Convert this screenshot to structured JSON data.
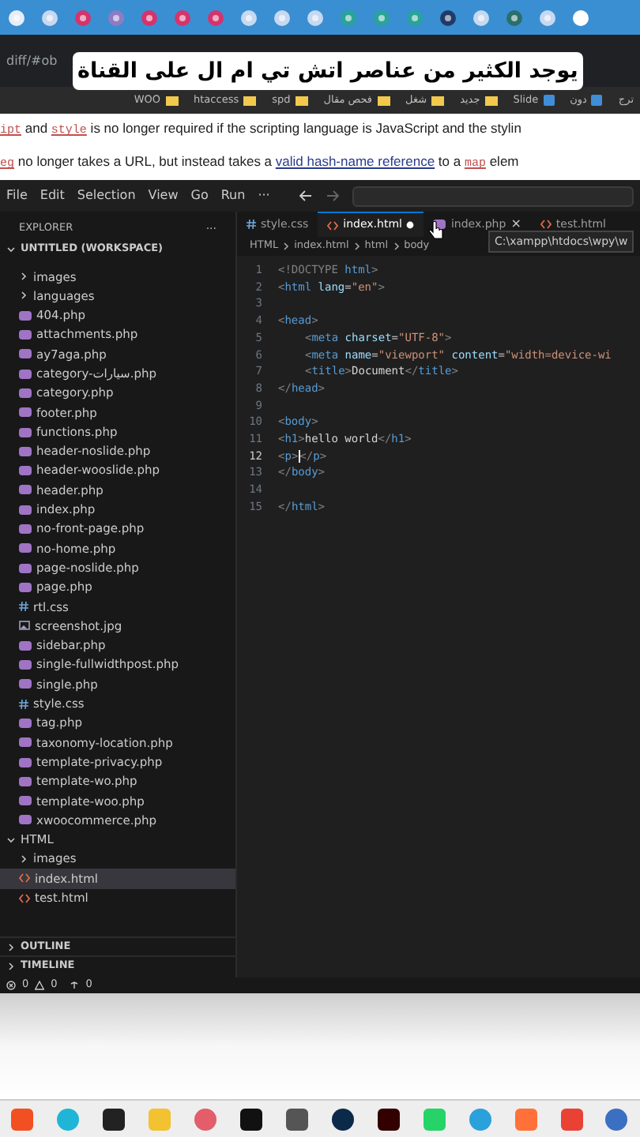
{
  "browser": {
    "address": "diff/#ob",
    "caption": "يوجد الكثير من عناصر اتش تي ام ال على القناة",
    "bookmarks": [
      {
        "label": "ترج",
        "kind": "text"
      },
      {
        "label": "دون",
        "kind": "app"
      },
      {
        "label": "Slide",
        "kind": "app"
      },
      {
        "label": "جديد",
        "kind": "folder"
      },
      {
        "label": "شغل",
        "kind": "folder"
      },
      {
        "label": "فحص مقال",
        "kind": "folder"
      },
      {
        "label": "spd",
        "kind": "folder"
      },
      {
        "label": "htaccess",
        "kind": "folder"
      },
      {
        "label": "WOO",
        "kind": "folder"
      }
    ],
    "page_lines": [
      [
        {
          "kind": "code",
          "t": "ipt"
        },
        {
          "kind": "text",
          "t": " and "
        },
        {
          "kind": "code",
          "t": "style"
        },
        {
          "kind": "text",
          "t": " is no longer required if the scripting language is JavaScript and the stylin"
        }
      ],
      [
        {
          "kind": "code",
          "t": "eg"
        },
        {
          "kind": "text",
          "t": " no longer takes a URL, but instead takes a "
        },
        {
          "kind": "link",
          "t": "valid hash-name reference"
        },
        {
          "kind": "text",
          "t": " to a "
        },
        {
          "kind": "code",
          "t": "map"
        },
        {
          "kind": "text",
          "t": " elem"
        }
      ]
    ]
  },
  "editor": {
    "menu": [
      "File",
      "Edit",
      "Selection",
      "View",
      "Go",
      "Run",
      "···"
    ],
    "explorer": {
      "title": "EXPLORER",
      "more": "···",
      "workspace": "UNTITLED (WORKSPACE)",
      "tree": [
        {
          "kind": "group",
          "children": [
            {
              "label": "images",
              "kind": "folder",
              "expanded": false,
              "selected": false
            },
            {
              "label": "languages",
              "kind": "folder",
              "expanded": false,
              "selected": false
            },
            {
              "label": "404.php",
              "kind": "php",
              "selected": false
            },
            {
              "label": "attachments.php",
              "kind": "php",
              "selected": false
            },
            {
              "label": "ay7aga.php",
              "kind": "php",
              "selected": false
            },
            {
              "label": "category-سيارات.php",
              "kind": "php",
              "selected": false
            },
            {
              "label": "category.php",
              "kind": "php",
              "selected": false
            },
            {
              "label": "footer.php",
              "kind": "php",
              "selected": false
            },
            {
              "label": "functions.php",
              "kind": "php",
              "selected": false
            },
            {
              "label": "header-noslide.php",
              "kind": "php",
              "selected": false
            },
            {
              "label": "header-wooslide.php",
              "kind": "php",
              "selected": false
            },
            {
              "label": "header.php",
              "kind": "php",
              "selected": false
            },
            {
              "label": "index.php",
              "kind": "php",
              "selected": false
            },
            {
              "label": "no-front-page.php",
              "kind": "php",
              "selected": false
            },
            {
              "label": "no-home.php",
              "kind": "php",
              "selected": false
            },
            {
              "label": "page-noslide.php",
              "kind": "php",
              "selected": false
            },
            {
              "label": "page.php",
              "kind": "php",
              "selected": false
            },
            {
              "label": "rtl.css",
              "kind": "css",
              "selected": false
            },
            {
              "label": "screenshot.jpg",
              "kind": "image",
              "selected": false
            },
            {
              "label": "sidebar.php",
              "kind": "php",
              "selected": false
            },
            {
              "label": "single-fullwidthpost.php",
              "kind": "php",
              "selected": false
            },
            {
              "label": "single.php",
              "kind": "php",
              "selected": false
            },
            {
              "label": "style.css",
              "kind": "css",
              "selected": false
            },
            {
              "label": "tag.php",
              "kind": "php",
              "selected": false
            },
            {
              "label": "taxonomy-location.php",
              "kind": "php",
              "selected": false
            },
            {
              "label": "template-privacy.php",
              "kind": "php",
              "selected": false
            },
            {
              "label": "template-wo.php",
              "kind": "php",
              "selected": false
            },
            {
              "label": "template-woo.php",
              "kind": "php",
              "selected": false
            },
            {
              "label": "xwoocommerce.php",
              "kind": "php",
              "selected": false
            }
          ]
        },
        {
          "label": "HTML",
          "kind": "folder",
          "expanded": true,
          "selected": false,
          "children": [
            {
              "label": "images",
              "kind": "folder",
              "expanded": false,
              "selected": false
            },
            {
              "label": "index.html",
              "kind": "html",
              "selected": true
            },
            {
              "label": "test.html",
              "kind": "html",
              "selected": false
            }
          ]
        }
      ],
      "panels": [
        {
          "label": "OUTLINE",
          "expanded": false
        },
        {
          "label": "TIMELINE",
          "expanded": false
        }
      ]
    },
    "tabs": [
      {
        "label": "style.css",
        "kind": "css",
        "selected": false,
        "modified": false
      },
      {
        "label": "index.html",
        "kind": "html",
        "selected": true,
        "modified": true
      },
      {
        "label": "index.php",
        "kind": "php",
        "selected": false,
        "modified": false,
        "close": "×"
      },
      {
        "label": "test.html",
        "kind": "html",
        "selected": false,
        "modified": false
      }
    ],
    "breadcrumb": [
      "HTML",
      "index.html",
      "html",
      "body"
    ],
    "tooltip": "C:\\xampp\\htdocs\\wpy\\w",
    "lines": [
      {
        "n": "1",
        "tokens": [
          {
            "kind": "punct",
            "t": "<!DOCTYPE "
          },
          {
            "kind": "tag",
            "t": "html"
          },
          {
            "kind": "punct",
            "t": ">"
          }
        ]
      },
      {
        "n": "2",
        "tokens": [
          {
            "kind": "punct",
            "t": "<"
          },
          {
            "kind": "tag",
            "t": "html"
          },
          {
            "kind": "attr",
            "t": " lang"
          },
          {
            "kind": "text",
            "t": "="
          },
          {
            "kind": "str",
            "t": "\"en\""
          },
          {
            "kind": "punct",
            "t": ">"
          }
        ]
      },
      {
        "n": "3"
      },
      {
        "n": "4",
        "tokens": [
          {
            "kind": "punct",
            "t": "<"
          },
          {
            "kind": "tag",
            "t": "head"
          },
          {
            "kind": "punct",
            "t": ">"
          }
        ]
      },
      {
        "n": "5",
        "indent": true,
        "tokens": [
          {
            "kind": "punct",
            "t": "<"
          },
          {
            "kind": "tag",
            "t": "meta"
          },
          {
            "kind": "attr",
            "t": " charset"
          },
          {
            "kind": "text",
            "t": "="
          },
          {
            "kind": "str",
            "t": "\"UTF-8\""
          },
          {
            "kind": "punct",
            "t": ">"
          }
        ]
      },
      {
        "n": "6",
        "indent": true,
        "tokens": [
          {
            "kind": "punct",
            "t": "<"
          },
          {
            "kind": "tag",
            "t": "meta"
          },
          {
            "kind": "attr",
            "t": " name"
          },
          {
            "kind": "text",
            "t": "="
          },
          {
            "kind": "str",
            "t": "\"viewport\""
          },
          {
            "kind": "attr",
            "t": " content"
          },
          {
            "kind": "text",
            "t": "="
          },
          {
            "kind": "str",
            "t": "\"width=device-wi"
          }
        ]
      },
      {
        "n": "7",
        "indent": true,
        "tokens": [
          {
            "kind": "punct",
            "t": "<"
          },
          {
            "kind": "tag",
            "t": "title"
          },
          {
            "kind": "punct",
            "t": ">"
          },
          {
            "kind": "text",
            "t": "Document"
          },
          {
            "kind": "punct",
            "t": "</"
          },
          {
            "kind": "tag",
            "t": "title"
          },
          {
            "kind": "punct",
            "t": ">"
          }
        ]
      },
      {
        "n": "8",
        "tokens": [
          {
            "kind": "punct",
            "t": "</"
          },
          {
            "kind": "tag",
            "t": "head"
          },
          {
            "kind": "punct",
            "t": ">"
          }
        ]
      },
      {
        "n": "9"
      },
      {
        "n": "10",
        "tokens": [
          {
            "kind": "punct",
            "t": "<"
          },
          {
            "kind": "tag",
            "t": "body"
          },
          {
            "kind": "punct",
            "t": ">"
          }
        ]
      },
      {
        "n": "11",
        "tokens": [
          {
            "kind": "punct",
            "t": "<"
          },
          {
            "kind": "tag",
            "t": "h1"
          },
          {
            "kind": "punct",
            "t": ">"
          },
          {
            "kind": "text",
            "t": "hello world"
          },
          {
            "kind": "punct",
            "t": "</"
          },
          {
            "kind": "tag",
            "t": "h1"
          },
          {
            "kind": "punct",
            "t": ">"
          }
        ]
      },
      {
        "n": "12",
        "current": true,
        "tokens": [
          {
            "kind": "punct",
            "t": "<"
          },
          {
            "kind": "tag",
            "t": "p"
          },
          {
            "kind": "punct",
            "t": ">"
          },
          {
            "kind": "cursor"
          },
          {
            "kind": "punct",
            "t": "</"
          },
          {
            "kind": "tag",
            "t": "p"
          },
          {
            "kind": "punct",
            "t": ">"
          }
        ]
      },
      {
        "n": "13",
        "tokens": [
          {
            "kind": "punct",
            "t": "</"
          },
          {
            "kind": "tag",
            "t": "body"
          },
          {
            "kind": "punct",
            "t": ">"
          }
        ]
      },
      {
        "n": "14"
      },
      {
        "n": "15",
        "tokens": [
          {
            "kind": "punct",
            "t": "</"
          },
          {
            "kind": "tag",
            "t": "html"
          },
          {
            "kind": "punct",
            "t": ">"
          }
        ]
      }
    ],
    "status": {
      "errors": "0",
      "warnings": "0",
      "ports": "0"
    }
  }
}
